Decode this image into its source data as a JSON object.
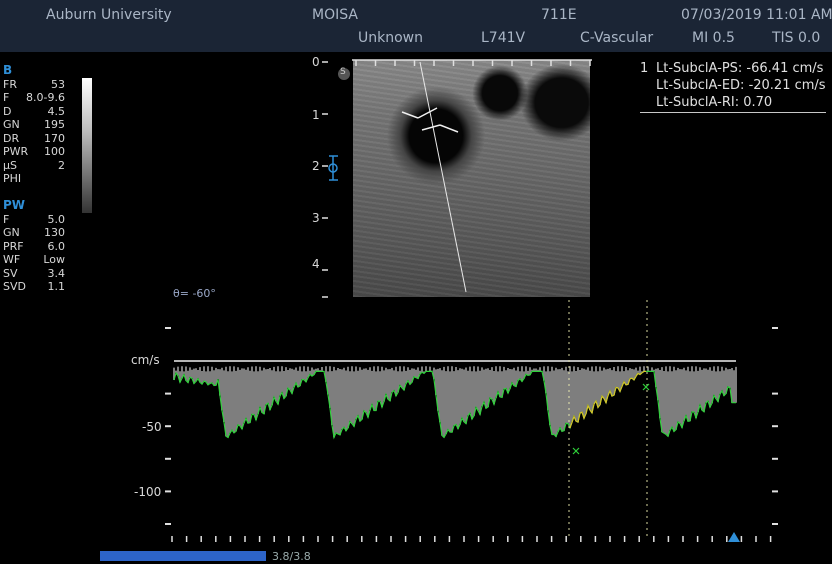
{
  "header": {
    "institution": "Auburn University",
    "operator": "MOISA",
    "station": "711E",
    "datetime": "07/03/2019 11:01 AM",
    "patient": "Unknown",
    "probe": "L741V",
    "preset": "C-Vascular",
    "mi": "MI 0.5",
    "tis": "TIS 0.0"
  },
  "b_mode": {
    "section_label": "B",
    "params": [
      {
        "key": "FR",
        "value": "53"
      },
      {
        "key": "F",
        "value": "8.0-9.6"
      },
      {
        "key": "D",
        "value": "4.5"
      },
      {
        "key": "GN",
        "value": "195"
      },
      {
        "key": "DR",
        "value": "170"
      },
      {
        "key": "PWR",
        "value": "100"
      },
      {
        "key": "µS",
        "value": "2"
      },
      {
        "key": "PHI",
        "value": ""
      }
    ]
  },
  "pw_mode": {
    "section_label": "PW",
    "params": [
      {
        "key": "F",
        "value": "5.0"
      },
      {
        "key": "GN",
        "value": "130"
      },
      {
        "key": "PRF",
        "value": "6.0"
      },
      {
        "key": "WF",
        "value": "Low"
      },
      {
        "key": "SV",
        "value": "3.4"
      },
      {
        "key": "SVD",
        "value": "1.1"
      }
    ]
  },
  "measurements": {
    "index": "1",
    "items": [
      "Lt-SubclA-PS: -66.41 cm/s",
      "Lt-SubclA-ED: -20.21 cm/s",
      "Lt-SubclA-RI: 0.70"
    ]
  },
  "depth_scale": {
    "labels": [
      "0",
      "1",
      "2",
      "3",
      "4"
    ],
    "s_marker": "S"
  },
  "angle": "θ= -60°",
  "doppler": {
    "unit_label": "cm/s",
    "ticks": [
      "-50",
      "-100"
    ],
    "min": -125,
    "max": 0
  },
  "cine": {
    "label": "3.8/3.8",
    "fraction": 1.0
  },
  "colors": {
    "header_bg": "#1b2535",
    "accent": "#2f8fd8",
    "trace_green": "#2fd03a",
    "trace_yellow": "#d8c028",
    "progress": "#2d64c8"
  }
}
